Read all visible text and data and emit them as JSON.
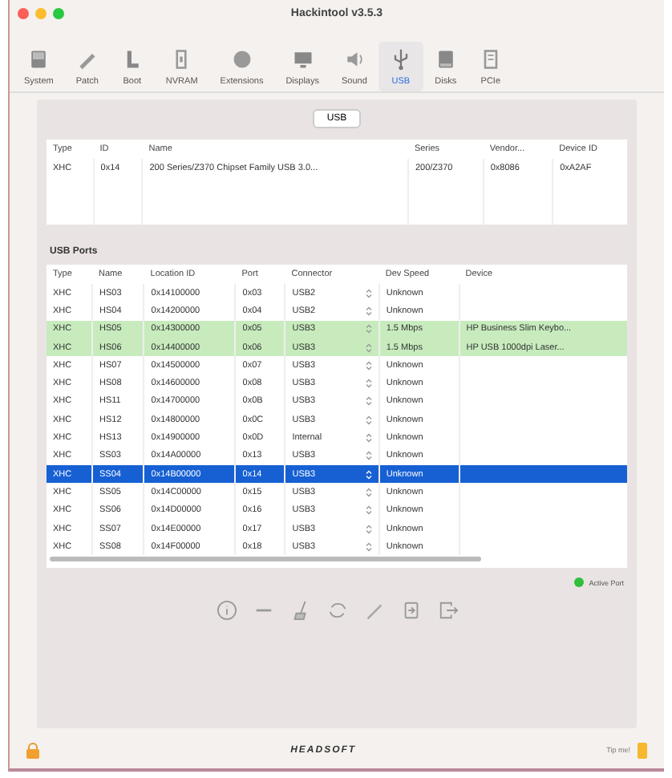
{
  "window": {
    "title": "Hackintool v3.5.3"
  },
  "toolbar": [
    {
      "label": "System",
      "selected": false
    },
    {
      "label": "Patch",
      "selected": false
    },
    {
      "label": "Boot",
      "selected": false
    },
    {
      "label": "NVRAM",
      "selected": false
    },
    {
      "label": "Extensions",
      "selected": false
    },
    {
      "label": "Displays",
      "selected": false
    },
    {
      "label": "Sound",
      "selected": false
    },
    {
      "label": "USB",
      "selected": true
    },
    {
      "label": "Disks",
      "selected": false
    },
    {
      "label": "PCIe",
      "selected": false
    }
  ],
  "segment": {
    "label": "USB"
  },
  "controllers": {
    "columns": [
      "Type",
      "ID",
      "Name",
      "Series",
      "Vendor...",
      "Device ID"
    ],
    "rows": [
      [
        "XHC",
        "0x14",
        "200 Series/Z370 Chipset Family USB 3.0...",
        "200/Z370",
        "0x8086",
        "0xA2AF"
      ]
    ]
  },
  "ports_title": "USB Ports",
  "ports": {
    "columns": [
      "Type",
      "Name",
      "Location ID",
      "Port",
      "Connector",
      "Dev Speed",
      "Device"
    ],
    "rows": [
      {
        "cells": [
          "XHC",
          "HS03",
          "0x14100000",
          "0x03",
          "USB2",
          "Unknown",
          ""
        ],
        "active": false,
        "selected": false
      },
      {
        "cells": [
          "XHC",
          "HS04",
          "0x14200000",
          "0x04",
          "USB2",
          "Unknown",
          ""
        ],
        "active": false,
        "selected": false
      },
      {
        "cells": [
          "XHC",
          "HS05",
          "0x14300000",
          "0x05",
          "USB3",
          "1.5 Mbps",
          "HP Business Slim Keybo..."
        ],
        "active": true,
        "selected": false
      },
      {
        "cells": [
          "XHC",
          "HS06",
          "0x14400000",
          "0x06",
          "USB3",
          "1.5 Mbps",
          "HP USB 1000dpi Laser..."
        ],
        "active": true,
        "selected": false
      },
      {
        "cells": [
          "XHC",
          "HS07",
          "0x14500000",
          "0x07",
          "USB3",
          "Unknown",
          ""
        ],
        "active": false,
        "selected": false
      },
      {
        "cells": [
          "XHC",
          "HS08",
          "0x14600000",
          "0x08",
          "USB3",
          "Unknown",
          ""
        ],
        "active": false,
        "selected": false
      },
      {
        "cells": [
          "XHC",
          "HS11",
          "0x14700000",
          "0x0B",
          "USB3",
          "Unknown",
          ""
        ],
        "active": false,
        "selected": false
      },
      {
        "cells": [
          "XHC",
          "HS12",
          "0x14800000",
          "0x0C",
          "USB3",
          "Unknown",
          ""
        ],
        "active": false,
        "selected": false
      },
      {
        "cells": [
          "XHC",
          "HS13",
          "0x14900000",
          "0x0D",
          "Internal",
          "Unknown",
          ""
        ],
        "active": false,
        "selected": false
      },
      {
        "cells": [
          "XHC",
          "SS03",
          "0x14A00000",
          "0x13",
          "USB3",
          "Unknown",
          ""
        ],
        "active": false,
        "selected": false
      },
      {
        "cells": [
          "XHC",
          "SS04",
          "0x14B00000",
          "0x14",
          "USB3",
          "Unknown",
          ""
        ],
        "active": false,
        "selected": true
      },
      {
        "cells": [
          "XHC",
          "SS05",
          "0x14C00000",
          "0x15",
          "USB3",
          "Unknown",
          ""
        ],
        "active": false,
        "selected": false
      },
      {
        "cells": [
          "XHC",
          "SS06",
          "0x14D00000",
          "0x16",
          "USB3",
          "Unknown",
          ""
        ],
        "active": false,
        "selected": false
      },
      {
        "cells": [
          "XHC",
          "SS07",
          "0x14E00000",
          "0x17",
          "USB3",
          "Unknown",
          ""
        ],
        "active": false,
        "selected": false
      },
      {
        "cells": [
          "XHC",
          "SS08",
          "0x14F00000",
          "0x18",
          "USB3",
          "Unknown",
          ""
        ],
        "active": false,
        "selected": false
      }
    ]
  },
  "legend": {
    "label": "Active Port",
    "color": "#2fbf3a"
  },
  "footer": {
    "brand": "HEADSOFT",
    "tip": "Tip me!"
  }
}
